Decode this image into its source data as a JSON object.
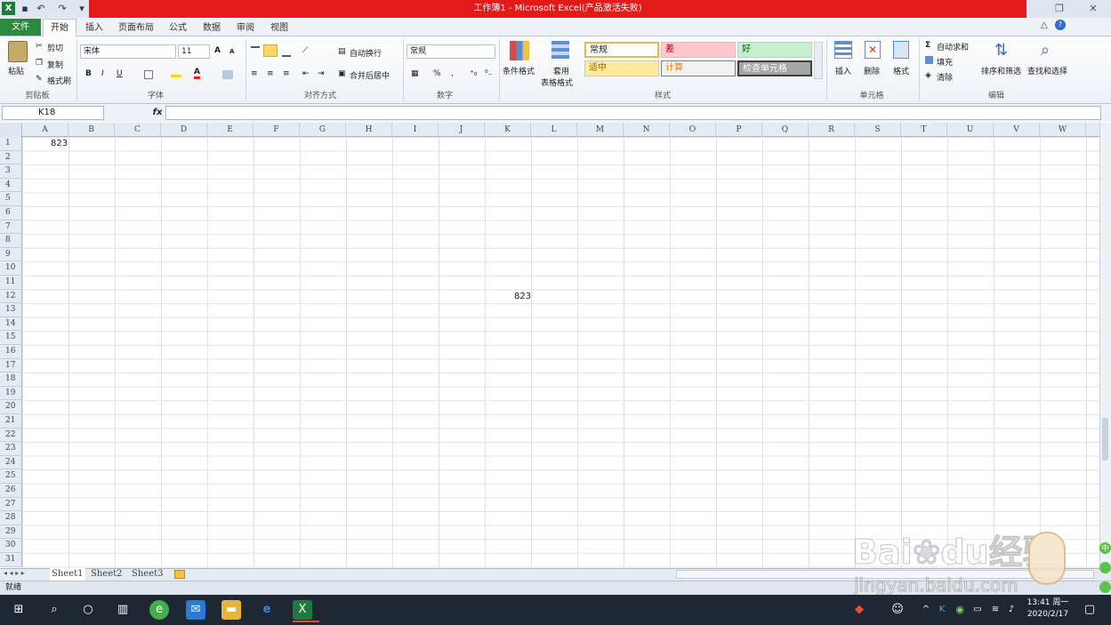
{
  "window": {
    "title": "工作簿1 - Microsoft Excel(产品激活失败)"
  },
  "ribbon_tabs": [
    "文件",
    "开始",
    "插入",
    "页面布局",
    "公式",
    "数据",
    "审阅",
    "视图"
  ],
  "clipboard": {
    "paste": "粘贴",
    "cut": "剪切",
    "copy": "复制",
    "format_painter": "格式刷",
    "group": "剪贴板"
  },
  "font": {
    "name": "宋体",
    "size": "11",
    "bold": "B",
    "italic": "I",
    "underline": "U",
    "group": "字体"
  },
  "alignment": {
    "wrap": "自动换行",
    "merge": "合并后居中",
    "group": "对齐方式"
  },
  "number": {
    "format": "常规",
    "percent": "%",
    "comma": ",",
    "group": "数字"
  },
  "styles": {
    "conditional": "条件格式",
    "table_fmt_1": "套用",
    "table_fmt_2": "表格格式",
    "normal": "常规",
    "bad": "差",
    "good": "好",
    "neutral": "适中",
    "calc": "计算",
    "check": "检查单元格",
    "group": "样式"
  },
  "cells_group": {
    "insert": "插入",
    "delete": "删除",
    "format": "格式",
    "group": "单元格"
  },
  "editing": {
    "autosum": "自动求和",
    "fill": "填充",
    "clear": "清除",
    "sort": "排序和筛选",
    "find": "查找和选择",
    "group": "编辑"
  },
  "formula_bar": {
    "name_box": "K18",
    "fx": "fx",
    "content": ""
  },
  "columns": [
    "A",
    "B",
    "C",
    "D",
    "E",
    "F",
    "G",
    "H",
    "I",
    "J",
    "K",
    "L",
    "M",
    "N",
    "O",
    "P",
    "Q",
    "R",
    "S",
    "T",
    "U",
    "V",
    "W"
  ],
  "rows": [
    "1",
    "2",
    "3",
    "4",
    "5",
    "6",
    "7",
    "8",
    "9",
    "10",
    "11",
    "12",
    "13",
    "14",
    "15",
    "16",
    "17",
    "18",
    "19",
    "20",
    "21",
    "22",
    "23",
    "24",
    "25",
    "26",
    "27",
    "28",
    "29",
    "30",
    "31"
  ],
  "cells": {
    "A1": "823",
    "K12": "823"
  },
  "sheets": [
    "Sheet1",
    "Sheet2",
    "Sheet3"
  ],
  "status": "就绪",
  "watermark": {
    "brand": "Bai",
    "brand2": "du",
    "brand3": "经验",
    "url": "jingyan.baidu.com"
  },
  "taskbar": {
    "time": "13:41 周一",
    "date": "2020/2/17"
  },
  "colors": {
    "accent": "#2b8a3e",
    "title_red": "#e41a1a",
    "bad": "#ffc7ce",
    "good": "#c6efce",
    "neutral": "#ffeb9c"
  }
}
